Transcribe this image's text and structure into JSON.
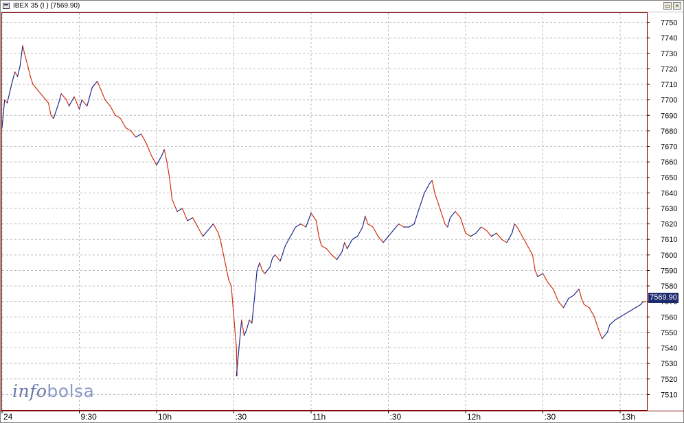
{
  "window": {
    "title": "IBEX 35 (I ) (7569.90)",
    "restore_label": "▭",
    "close_label": "×"
  },
  "logo": {
    "part1": "info",
    "part2": "bolsa"
  },
  "last_price_label": "7569.90",
  "colors": {
    "up": "#1e2a8c",
    "down": "#d03010",
    "grid": "#b8b8b8",
    "frame": "#800000",
    "price_tag": "#1e2a6e"
  },
  "chart_data": {
    "type": "line",
    "title": "",
    "xlabel": "",
    "ylabel": "",
    "ylim": [
      7500,
      7756
    ],
    "yticks": [
      7510,
      7520,
      7530,
      7540,
      7550,
      7560,
      7570,
      7580,
      7590,
      7600,
      7610,
      7620,
      7630,
      7640,
      7650,
      7660,
      7670,
      7680,
      7690,
      7700,
      7710,
      7720,
      7730,
      7740,
      7750
    ],
    "xlim": [
      "09:00",
      "13:11"
    ],
    "xticks": [
      {
        "t": "09:00",
        "label": "24"
      },
      {
        "t": "09:30",
        "label": "9:30"
      },
      {
        "t": "10:00",
        "label": "10h"
      },
      {
        "t": "10:30",
        "label": ":30"
      },
      {
        "t": "11:00",
        "label": "11h"
      },
      {
        "t": "11:30",
        "label": ":30"
      },
      {
        "t": "12:00",
        "label": "12h"
      },
      {
        "t": "12:30",
        "label": ":30"
      },
      {
        "t": "13:00",
        "label": "13h"
      }
    ],
    "grid": true,
    "series": [
      {
        "points": [
          [
            "09:00",
            7682
          ],
          [
            "09:01",
            7700
          ],
          [
            "09:02",
            7698
          ],
          [
            "09:03",
            7705
          ],
          [
            "09:04",
            7712
          ],
          [
            "09:05",
            7718
          ],
          [
            "09:06",
            7715
          ],
          [
            "09:07",
            7722
          ],
          [
            "09:08",
            7735
          ],
          [
            "09:09",
            7728
          ],
          [
            "09:10",
            7722
          ],
          [
            "09:11",
            7715
          ],
          [
            "09:12",
            7710
          ],
          [
            "09:13",
            7708
          ],
          [
            "09:14",
            7706
          ],
          [
            "09:16",
            7702
          ],
          [
            "09:18",
            7698
          ],
          [
            "09:19",
            7690
          ],
          [
            "09:20",
            7688
          ],
          [
            "09:22",
            7698
          ],
          [
            "09:23",
            7704
          ],
          [
            "09:25",
            7700
          ],
          [
            "09:26",
            7696
          ],
          [
            "09:28",
            7702
          ],
          [
            "09:30",
            7694
          ],
          [
            "09:31",
            7700
          ],
          [
            "09:33",
            7696
          ],
          [
            "09:35",
            7708
          ],
          [
            "09:37",
            7712
          ],
          [
            "09:38",
            7708
          ],
          [
            "09:40",
            7700
          ],
          [
            "09:42",
            7696
          ],
          [
            "09:44",
            7690
          ],
          [
            "09:46",
            7688
          ],
          [
            "09:48",
            7682
          ],
          [
            "09:50",
            7680
          ],
          [
            "09:52",
            7676
          ],
          [
            "09:54",
            7678
          ],
          [
            "09:56",
            7672
          ],
          [
            "09:58",
            7664
          ],
          [
            "10:00",
            7658
          ],
          [
            "10:02",
            7664
          ],
          [
            "10:03",
            7668
          ],
          [
            "10:04",
            7660
          ],
          [
            "10:05",
            7650
          ],
          [
            "10:06",
            7636
          ],
          [
            "10:07",
            7632
          ],
          [
            "10:08",
            7628
          ],
          [
            "10:10",
            7630
          ],
          [
            "10:12",
            7622
          ],
          [
            "10:14",
            7624
          ],
          [
            "10:16",
            7618
          ],
          [
            "10:18",
            7612
          ],
          [
            "10:20",
            7616
          ],
          [
            "10:22",
            7620
          ],
          [
            "10:24",
            7614
          ],
          [
            "10:25",
            7608
          ],
          [
            "10:26",
            7600
          ],
          [
            "10:27",
            7592
          ],
          [
            "10:28",
            7584
          ],
          [
            "10:29",
            7580
          ],
          [
            "10:30",
            7560
          ],
          [
            "10:31",
            7540
          ],
          [
            "10:31",
            7522
          ],
          [
            "10:32",
            7540
          ],
          [
            "10:33",
            7558
          ],
          [
            "10:34",
            7548
          ],
          [
            "10:35",
            7552
          ],
          [
            "10:36",
            7558
          ],
          [
            "10:37",
            7556
          ],
          [
            "10:38",
            7572
          ],
          [
            "10:39",
            7590
          ],
          [
            "10:40",
            7595
          ],
          [
            "10:41",
            7590
          ],
          [
            "10:42",
            7588
          ],
          [
            "10:44",
            7592
          ],
          [
            "10:45",
            7598
          ],
          [
            "10:46",
            7600
          ],
          [
            "10:48",
            7596
          ],
          [
            "10:50",
            7606
          ],
          [
            "10:52",
            7612
          ],
          [
            "10:54",
            7618
          ],
          [
            "10:56",
            7620
          ],
          [
            "10:58",
            7618
          ],
          [
            "11:00",
            7627
          ],
          [
            "11:02",
            7622
          ],
          [
            "11:03",
            7612
          ],
          [
            "11:04",
            7606
          ],
          [
            "11:06",
            7604
          ],
          [
            "11:08",
            7600
          ],
          [
            "11:10",
            7597
          ],
          [
            "11:12",
            7602
          ],
          [
            "11:13",
            7608
          ],
          [
            "11:14",
            7604
          ],
          [
            "11:16",
            7610
          ],
          [
            "11:18",
            7612
          ],
          [
            "11:20",
            7618
          ],
          [
            "11:21",
            7625
          ],
          [
            "11:22",
            7620
          ],
          [
            "11:24",
            7618
          ],
          [
            "11:26",
            7612
          ],
          [
            "11:28",
            7608
          ],
          [
            "11:30",
            7612
          ],
          [
            "11:32",
            7616
          ],
          [
            "11:34",
            7620
          ],
          [
            "11:36",
            7618
          ],
          [
            "11:38",
            7618
          ],
          [
            "11:40",
            7620
          ],
          [
            "11:42",
            7630
          ],
          [
            "11:44",
            7640
          ],
          [
            "11:46",
            7646
          ],
          [
            "11:47",
            7648
          ],
          [
            "11:48",
            7640
          ],
          [
            "11:50",
            7630
          ],
          [
            "11:52",
            7620
          ],
          [
            "11:53",
            7618
          ],
          [
            "11:54",
            7624
          ],
          [
            "11:56",
            7628
          ],
          [
            "11:58",
            7624
          ],
          [
            "12:00",
            7614
          ],
          [
            "12:02",
            7612
          ],
          [
            "12:04",
            7614
          ],
          [
            "12:06",
            7618
          ],
          [
            "12:08",
            7616
          ],
          [
            "12:10",
            7612
          ],
          [
            "12:12",
            7614
          ],
          [
            "12:14",
            7610
          ],
          [
            "12:16",
            7608
          ],
          [
            "12:18",
            7614
          ],
          [
            "12:19",
            7620
          ],
          [
            "12:20",
            7618
          ],
          [
            "12:22",
            7612
          ],
          [
            "12:24",
            7606
          ],
          [
            "12:26",
            7600
          ],
          [
            "12:27",
            7590
          ],
          [
            "12:28",
            7586
          ],
          [
            "12:30",
            7588
          ],
          [
            "12:32",
            7582
          ],
          [
            "12:34",
            7578
          ],
          [
            "12:36",
            7570
          ],
          [
            "12:38",
            7566
          ],
          [
            "12:40",
            7572
          ],
          [
            "12:42",
            7574
          ],
          [
            "12:44",
            7578
          ],
          [
            "12:45",
            7572
          ],
          [
            "12:46",
            7568
          ],
          [
            "12:48",
            7566
          ],
          [
            "12:50",
            7560
          ],
          [
            "12:52",
            7550
          ],
          [
            "12:53",
            7546
          ],
          [
            "12:55",
            7550
          ],
          [
            "12:56",
            7555
          ],
          [
            "12:58",
            7558
          ],
          [
            "13:00",
            7560
          ],
          [
            "13:02",
            7562
          ],
          [
            "13:04",
            7564
          ],
          [
            "13:06",
            7566
          ],
          [
            "13:08",
            7568
          ],
          [
            "13:09",
            7570
          ],
          [
            "13:10",
            7569.9
          ]
        ]
      }
    ]
  }
}
